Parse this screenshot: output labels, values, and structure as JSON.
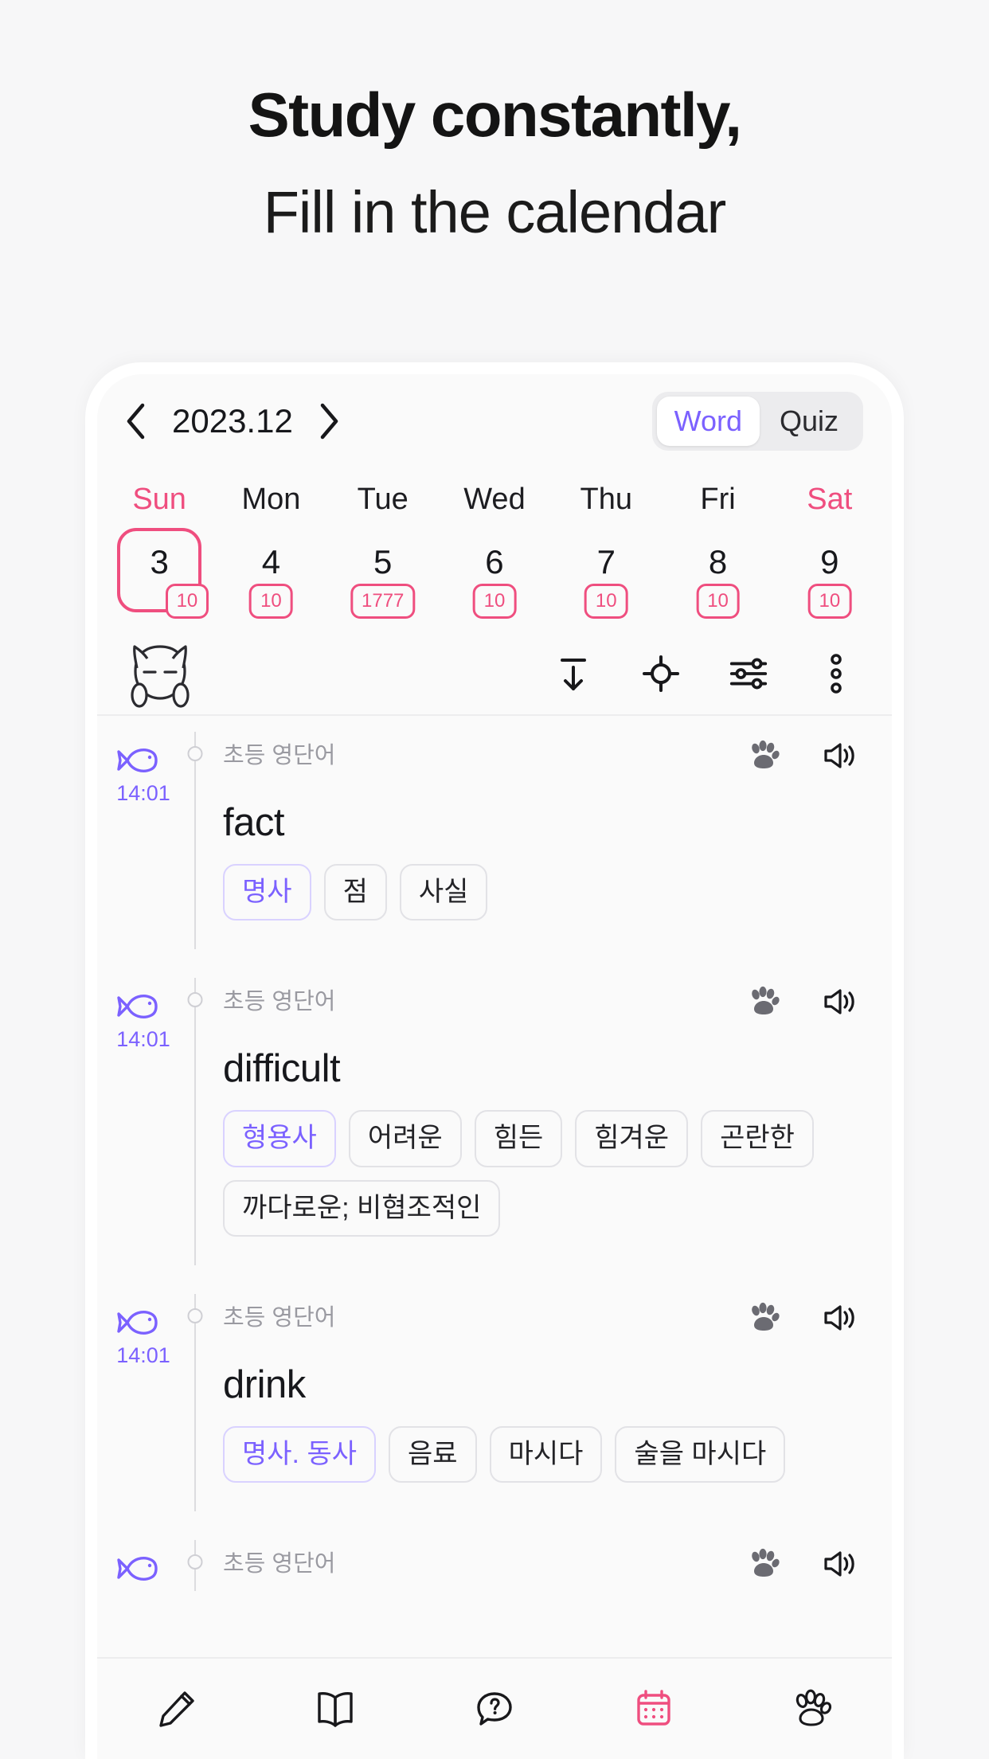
{
  "headline": {
    "line1": "Study constantly,",
    "line2": "Fill in the calendar"
  },
  "colors": {
    "accent_purple": "#7b61ff",
    "accent_pink": "#ef4e7f",
    "text_dark": "#17181c",
    "text_muted": "#9a9aa1",
    "surface": "#fafafa"
  },
  "app": {
    "header": {
      "prev_label": "‹",
      "month": "2023.12",
      "next_label": "›",
      "segments": [
        {
          "label": "Word",
          "active": true
        },
        {
          "label": "Quiz",
          "active": false
        }
      ]
    },
    "calendar": {
      "weekdays": [
        "Sun",
        "Mon",
        "Tue",
        "Wed",
        "Thu",
        "Fri",
        "Sat"
      ],
      "days": [
        {
          "num": "3",
          "badge": "10",
          "selected": true
        },
        {
          "num": "4",
          "badge": "10",
          "selected": false
        },
        {
          "num": "5",
          "badge": "1777",
          "selected": false
        },
        {
          "num": "6",
          "badge": "10",
          "selected": false
        },
        {
          "num": "7",
          "badge": "10",
          "selected": false
        },
        {
          "num": "8",
          "badge": "10",
          "selected": false
        },
        {
          "num": "9",
          "badge": "10",
          "selected": false
        }
      ]
    },
    "toolbar": {
      "mascot": "cat-mascot-icon",
      "icons": [
        "collapse-down-icon",
        "target-icon",
        "filter-sliders-icon",
        "more-options-icon"
      ]
    },
    "entries": [
      {
        "time": "14:01",
        "category": "초등 영단어",
        "word": "fact",
        "tags": [
          {
            "text": "명사",
            "pos": true
          },
          {
            "text": "점",
            "pos": false
          },
          {
            "text": "사실",
            "pos": false
          }
        ]
      },
      {
        "time": "14:01",
        "category": "초등 영단어",
        "word": "difficult",
        "tags": [
          {
            "text": "형용사",
            "pos": true
          },
          {
            "text": "어려운",
            "pos": false
          },
          {
            "text": "힘든",
            "pos": false
          },
          {
            "text": "힘겨운",
            "pos": false
          },
          {
            "text": "곤란한",
            "pos": false
          },
          {
            "text": "까다로운; 비협조적인",
            "pos": false
          }
        ]
      },
      {
        "time": "14:01",
        "category": "초등 영단어",
        "word": "drink",
        "tags": [
          {
            "text": "명사. 동사",
            "pos": true
          },
          {
            "text": "음료",
            "pos": false
          },
          {
            "text": "마시다",
            "pos": false
          },
          {
            "text": "술을 마시다",
            "pos": false
          }
        ]
      },
      {
        "time": "",
        "category": "초등 영단어",
        "word": "",
        "tags": []
      }
    ],
    "entry_icons": [
      "paw-icon",
      "speaker-icon"
    ],
    "bottom_nav": [
      {
        "name": "pencil",
        "active": false
      },
      {
        "name": "book",
        "active": false
      },
      {
        "name": "quiz-bubble",
        "active": false
      },
      {
        "name": "calendar",
        "active": true
      },
      {
        "name": "paw",
        "active": false
      }
    ]
  }
}
